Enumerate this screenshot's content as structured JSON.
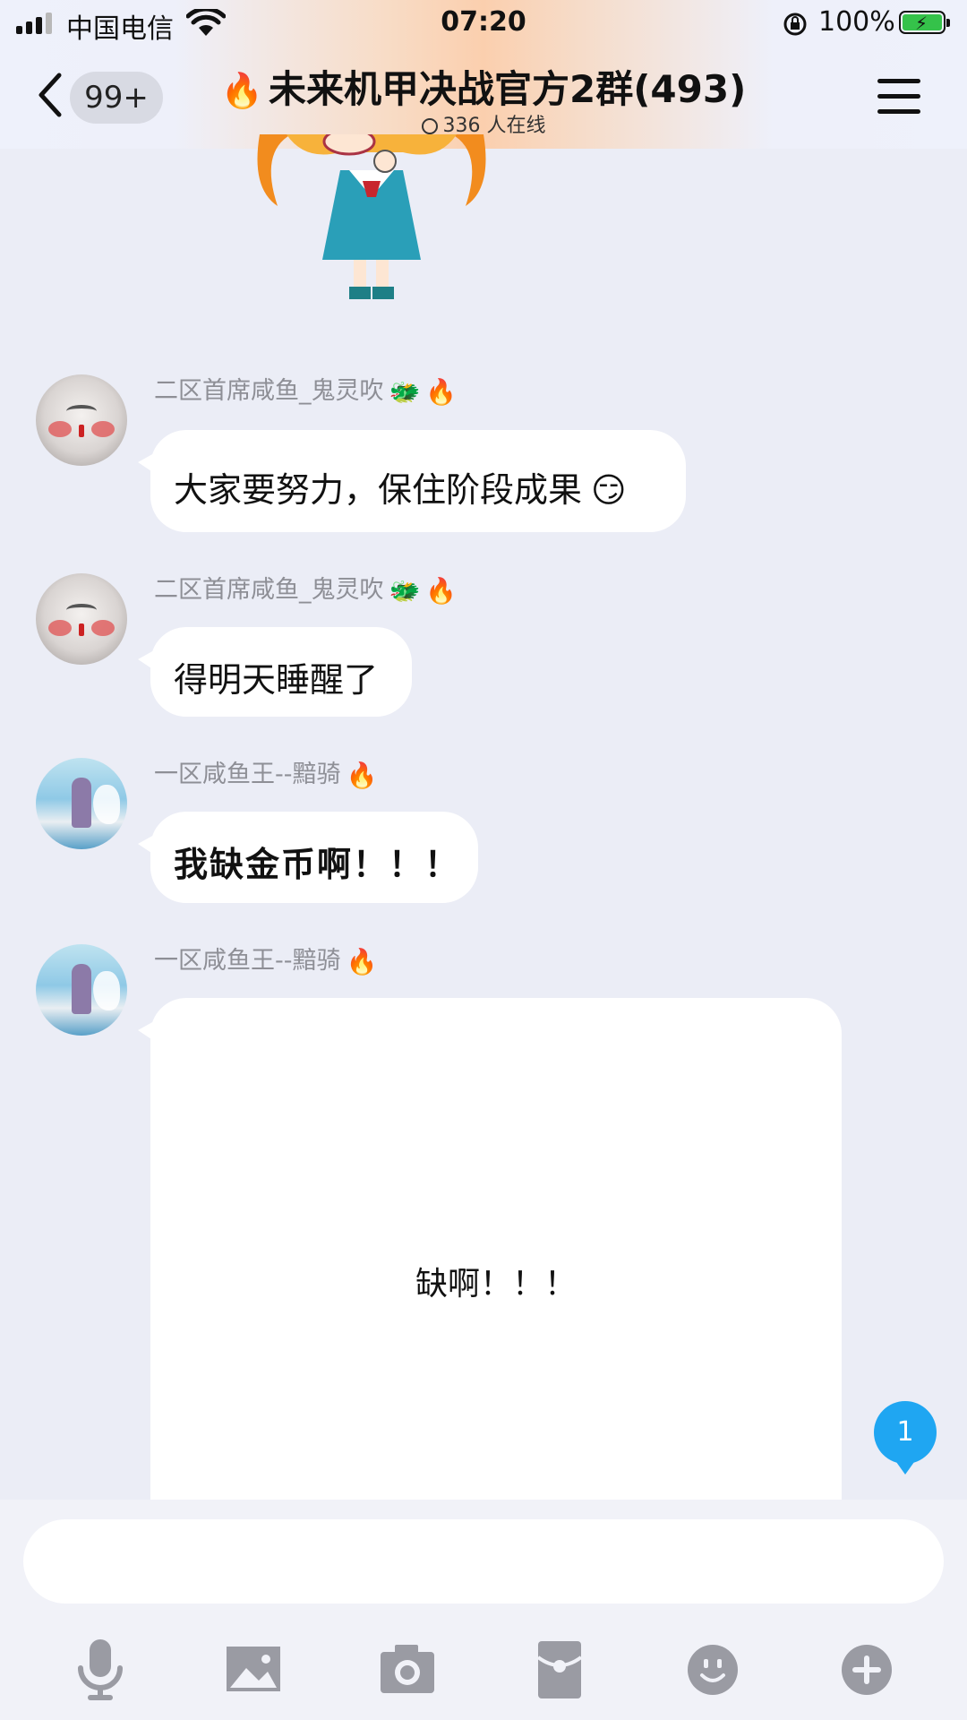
{
  "status_bar": {
    "carrier": "中国电信",
    "time": "07:20",
    "battery": "100%",
    "signal_bars": 3
  },
  "header": {
    "unread": "99+",
    "title": "未来机甲决战官方2群(493)",
    "online": "336 人在线"
  },
  "messages": [
    {
      "sender": "二区首席咸鱼_鬼灵吹",
      "text": "大家要努力，保住阶段成果",
      "emoji": "😏"
    },
    {
      "sender": "二区首席咸鱼_鬼灵吹",
      "text": "得明天睡醒了"
    },
    {
      "sender": "一区咸鱼王--黯骑",
      "text": "我缺金币啊！！！"
    },
    {
      "sender": "一区咸鱼王--黯骑",
      "text": "缺啊！！！"
    }
  ],
  "new_message_count": "1",
  "input": {
    "value": "",
    "placeholder": ""
  },
  "toolbar": [
    "mic-icon",
    "image-icon",
    "camera-icon",
    "red-packet-icon",
    "emoji-icon",
    "plus-icon"
  ],
  "colors": {
    "accent": "#1fa6f2",
    "bubble": "#ffffff",
    "background": "#ebedf6",
    "icon": "#9a9ba3"
  }
}
